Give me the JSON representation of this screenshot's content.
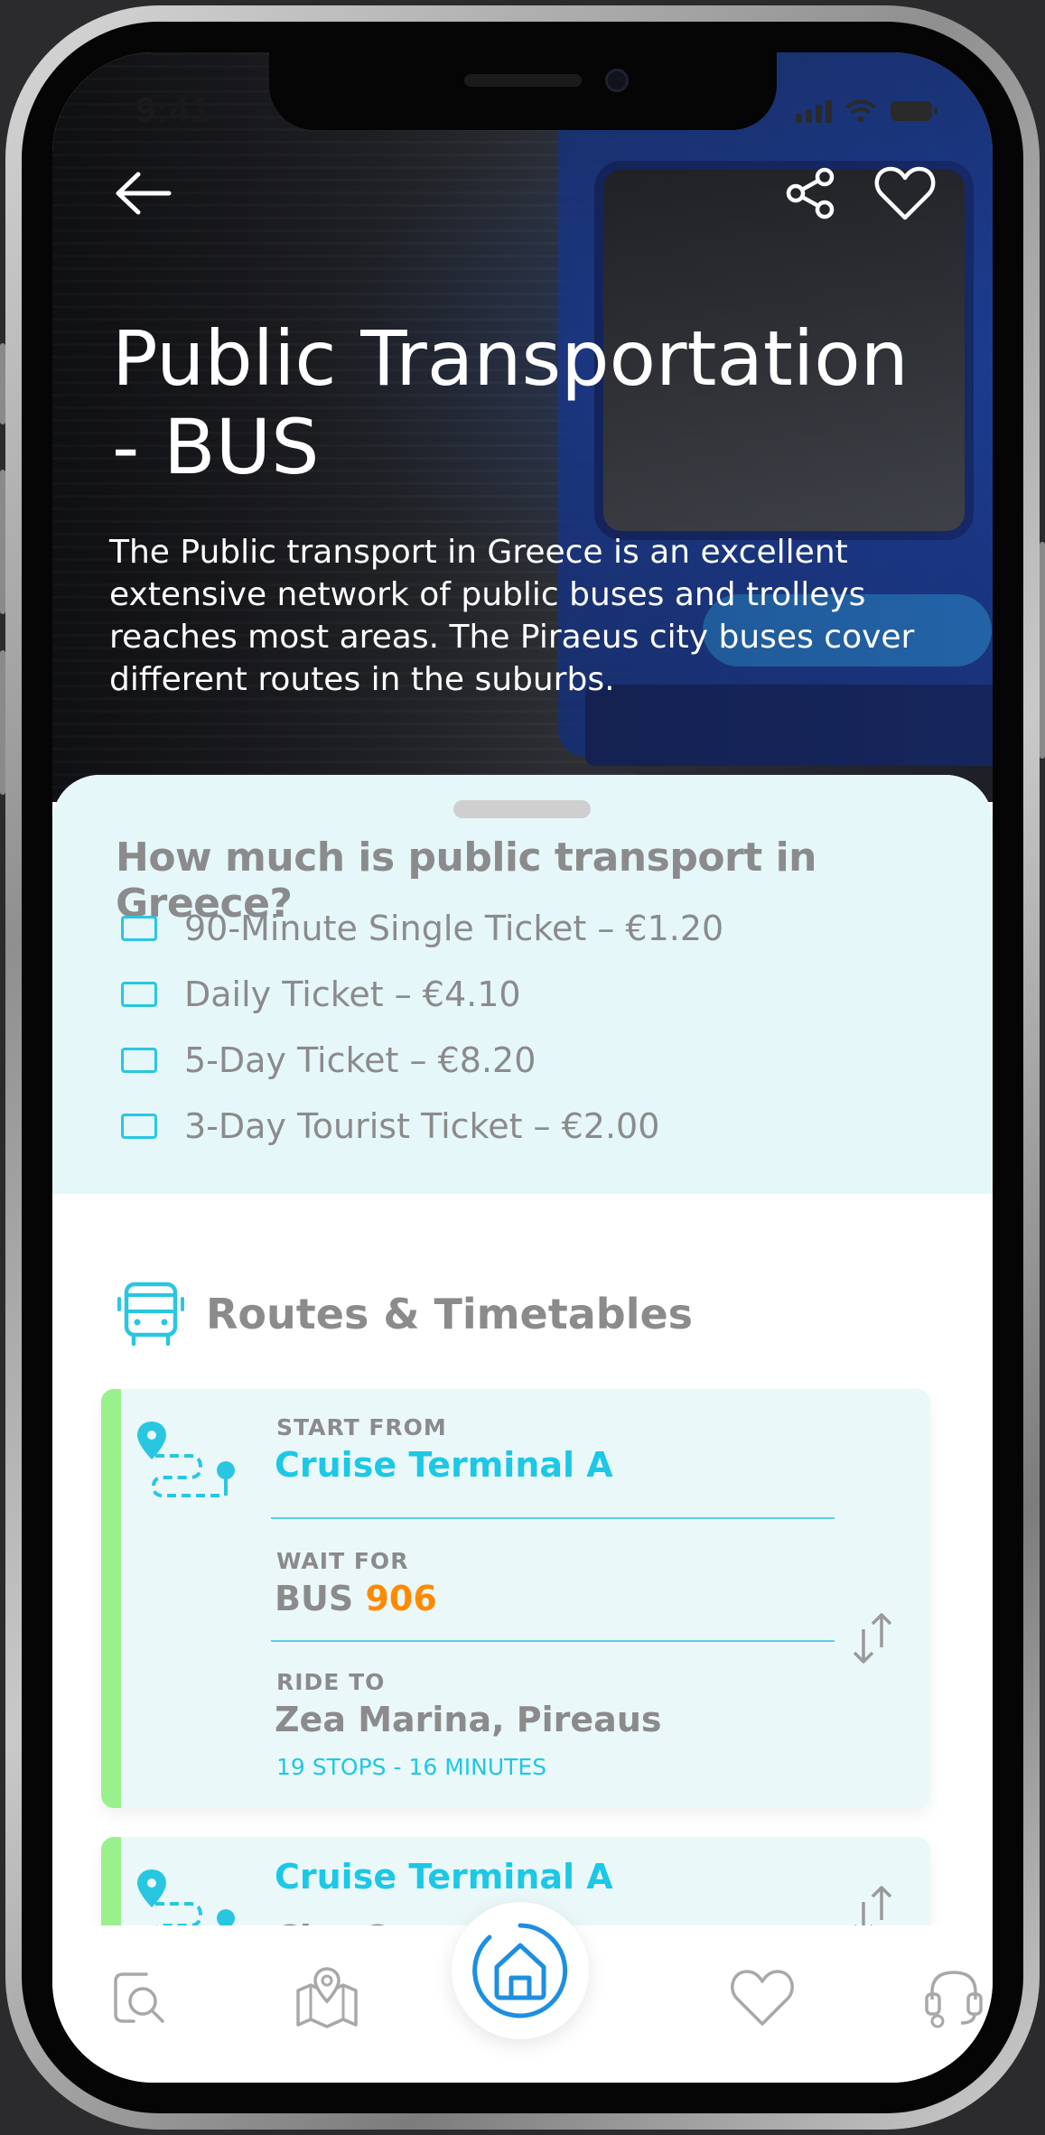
{
  "status_bar": {
    "time": "9:41"
  },
  "hero": {
    "title": "Public Transportation - BUS",
    "description": "The Public transport in Greece is an excellent extensive network of public buses and trolleys reaches most areas. The Piraeus city buses cover different routes in the suburbs."
  },
  "prices": {
    "question": "How much is public transport in Greece?",
    "tickets": [
      "90-Minute Single Ticket – €1.20",
      "Daily Ticket – €4.10",
      "5-Day Ticket – €8.20",
      "3-Day Tourist Ticket – €2.00"
    ]
  },
  "routes": {
    "title": "Routes & Timetables",
    "card1": {
      "start_label": "START FROM",
      "start": "Cruise Terminal A",
      "wait_label": "WAIT FOR",
      "bus_prefix": "BUS",
      "bus_number": "906",
      "ride_label": "RIDE TO",
      "destination": "Zea Marina, Pireaus",
      "stops": "19 STOPS - 16 MINUTES"
    },
    "card2": {
      "start": "Cruise Terminal A",
      "destination": "City Center, Pireaus"
    }
  },
  "colors": {
    "accent_cyan": "#1cc8e5",
    "accent_orange": "#ff8a00",
    "accent_green": "#99f08d",
    "sheet_bg": "#e6f7fa",
    "text_grey": "#8b8b8b"
  },
  "icons": {
    "back": "arrow-left-icon",
    "share": "share-icon",
    "favorite": "heart-icon",
    "bus": "bus-icon",
    "route": "route-pin-icon",
    "swap": "swap-arrows-icon",
    "nav": [
      "search-icon",
      "map-icon",
      "home-icon",
      "heart-icon",
      "support-icon"
    ]
  }
}
